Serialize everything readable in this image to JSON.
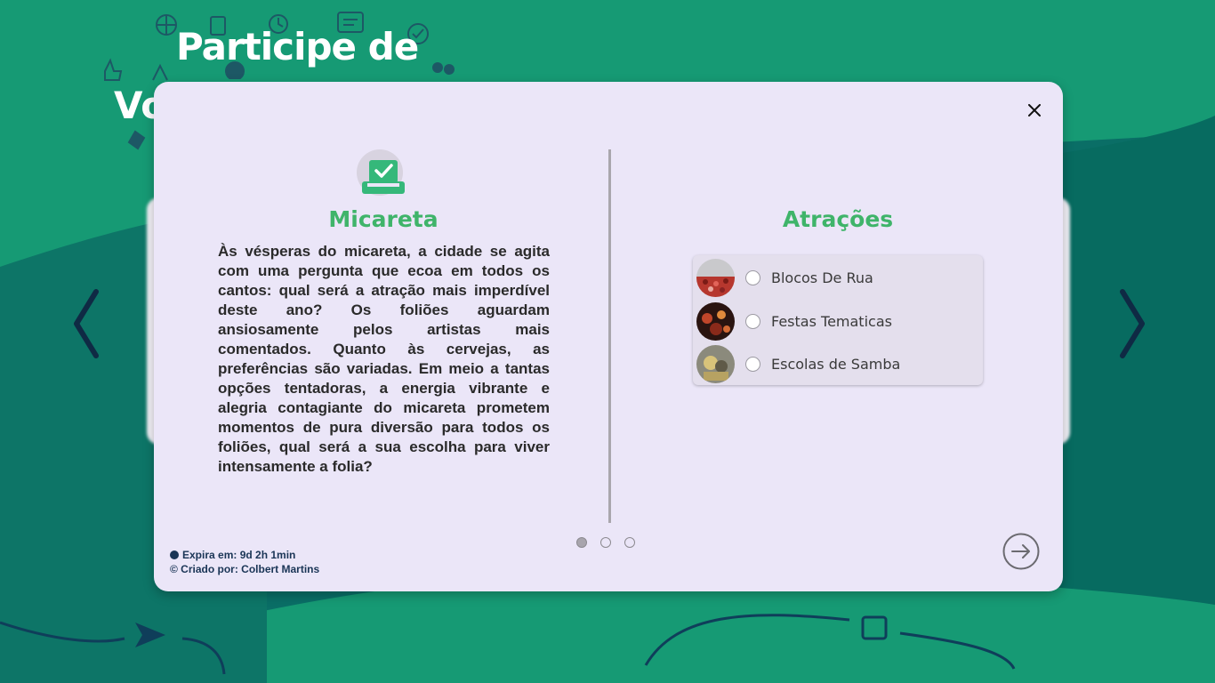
{
  "hero": {
    "title_line1": "Participe de",
    "title_line2": "Vo"
  },
  "poll": {
    "title": "Micareta",
    "description": "Às vésperas do micareta, a cidade se agita com uma pergunta que ecoa em todos os cantos: qual será a atração mais imperdível deste ano? Os foliões aguardam ansiosamente pelos artistas mais comentados. Quanto às cervejas, as preferências são variadas. Em meio a tantas opções tentadoras, a energia vibrante e alegria contagiante do micareta prometem momentos de pura diversão para todos os foliões, qual será a sua escolha para viver intensamente a folia?",
    "icon": "ballot-check-icon"
  },
  "options": {
    "title": "Atrações",
    "items": [
      {
        "label": "Blocos De Rua",
        "selected": false
      },
      {
        "label": "Festas Tematicas",
        "selected": false
      },
      {
        "label": "Escolas de Samba",
        "selected": false
      }
    ]
  },
  "pagination": {
    "total": 3,
    "current": 1
  },
  "footer": {
    "expires": "Expira em: 9d 2h 1min",
    "created_by": "© Criado por: Colbert Martins"
  },
  "colors": {
    "background": "#169a74",
    "accent_green": "#3fb46a",
    "modal_bg": "#ebe6f8",
    "navy": "#1a3556"
  },
  "icons": {
    "close": "close-icon",
    "prev": "chevron-left-icon",
    "next": "chevron-right-icon",
    "submit": "arrow-right-circle-icon"
  }
}
